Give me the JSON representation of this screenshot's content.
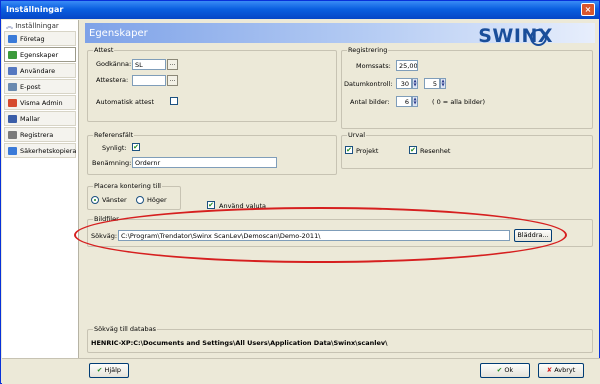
{
  "window": {
    "title": "Inställningar",
    "close": "×"
  },
  "sidebar": {
    "header": "Inställningar",
    "items": [
      {
        "label": "Företag",
        "color": "#3a7ad8"
      },
      {
        "label": "Egenskaper",
        "color": "#3b9a3b"
      },
      {
        "label": "Användare",
        "color": "#5578c0"
      },
      {
        "label": "E-post",
        "color": "#6a8ab0"
      },
      {
        "label": "Visma Admin",
        "color": "#d64a2e"
      },
      {
        "label": "Mallar",
        "color": "#3b5ea8"
      },
      {
        "label": "Registrera",
        "color": "#7a7a7a"
      },
      {
        "label": "Säkerhetskopiera",
        "color": "#3a7ad8"
      }
    ],
    "active_index": 1
  },
  "header": {
    "title": "Egenskaper",
    "logo": "SWINX"
  },
  "attest": {
    "legend": "Attest",
    "godkanna_label": "Godkänna:",
    "godkanna_value": "SL",
    "attestera_label": "Attestera:",
    "attestera_value": "",
    "auto_label": "Automatisk attest",
    "auto_checked": false,
    "dots": "..."
  },
  "registrering": {
    "legend": "Registrering",
    "momssats_label": "Momssats:",
    "momssats_value": "25,00",
    "datum_label": "Datumkontroll:",
    "datum_value1": "30",
    "datum_value2": "5",
    "antal_label": "Antal bilder:",
    "antal_value": "6",
    "antal_hint": "( 0 = alla bilder)"
  },
  "referens": {
    "legend": "Referensfält",
    "synligt_label": "Synligt:",
    "synligt_checked": true,
    "benamning_label": "Benämning:",
    "benamning_value": "Ordernr"
  },
  "urval": {
    "legend": "Urval",
    "projekt_label": "Projekt",
    "resenhet_label": "Resenhet"
  },
  "placering": {
    "legend": "Placera kontering till",
    "vanster": "Vänster",
    "hoger": "Höger",
    "selected": "Vänster"
  },
  "valuta": {
    "label": "Använd valuta",
    "checked": true
  },
  "bildfiler": {
    "legend": "Bildfiler",
    "sokvag_label": "Sökväg:",
    "sokvag_value": "C:\\Program\\Trendator\\Swinx ScanLev\\Demoscan\\Demo-2011\\",
    "browse_label": "Bläddra..."
  },
  "databas": {
    "legend": "Sökväg till databas",
    "path": "HENRIC-XP:C:\\Documents and Settings\\All Users\\Application Data\\Swinx\\scanlev\\"
  },
  "buttons": {
    "help": "Hjälp",
    "ok": "Ok",
    "cancel": "Avbryt"
  },
  "check_mark": "✔"
}
